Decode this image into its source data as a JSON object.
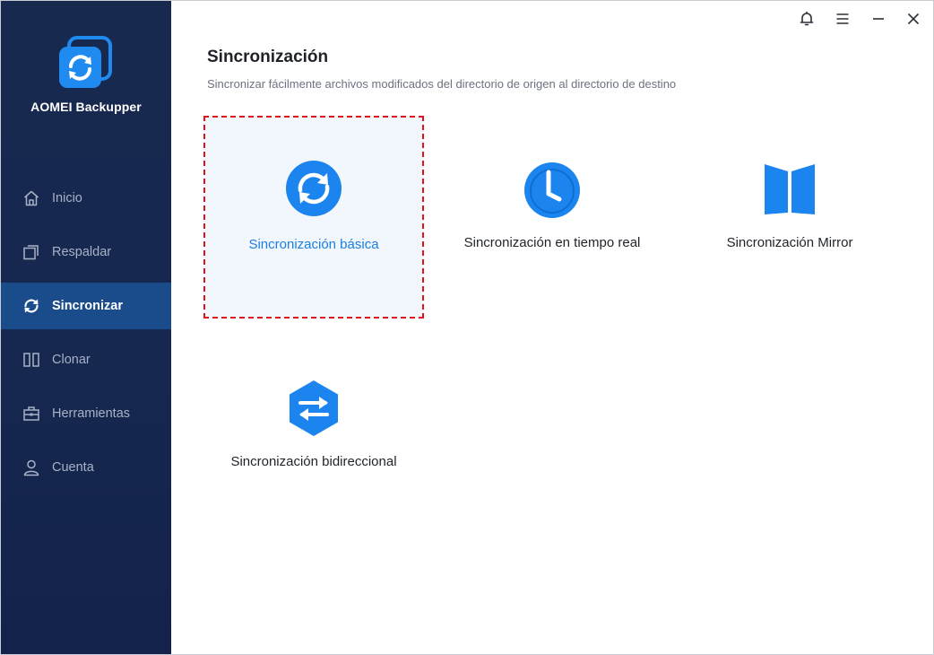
{
  "app": {
    "name": "AOMEI Backupper"
  },
  "sidebar": {
    "items": [
      {
        "label": "Inicio",
        "icon": "home-icon",
        "active": false
      },
      {
        "label": "Respaldar",
        "icon": "backup-icon",
        "active": false
      },
      {
        "label": "Sincronizar",
        "icon": "sync-icon",
        "active": true
      },
      {
        "label": "Clonar",
        "icon": "clone-icon",
        "active": false
      },
      {
        "label": "Herramientas",
        "icon": "toolbox-icon",
        "active": false
      },
      {
        "label": "Cuenta",
        "icon": "user-icon",
        "active": false
      }
    ]
  },
  "titlebar": {
    "icons": [
      "bell-icon",
      "menu-icon",
      "minimize-icon",
      "close-icon"
    ]
  },
  "main": {
    "title": "Sincronización",
    "subtitle": "Sincronizar fácilmente archivos modificados del directorio de origen al directorio de destino",
    "options": [
      {
        "label": "Sincronización básica",
        "icon": "sync-circle-icon",
        "selected": true
      },
      {
        "label": "Sincronización en tiempo real",
        "icon": "clock-icon",
        "selected": false
      },
      {
        "label": "Sincronización Mirror",
        "icon": "mirror-icon",
        "selected": false
      },
      {
        "label": "Sincronización bidireccional",
        "icon": "two-way-arrows-icon",
        "selected": false
      }
    ]
  },
  "colors": {
    "sidebar_bg": "#162850",
    "sidebar_active": "#1a4c8c",
    "accent": "#1b7fe0",
    "selection_border": "#e0111b",
    "selection_bg": "#f1f7fd"
  }
}
